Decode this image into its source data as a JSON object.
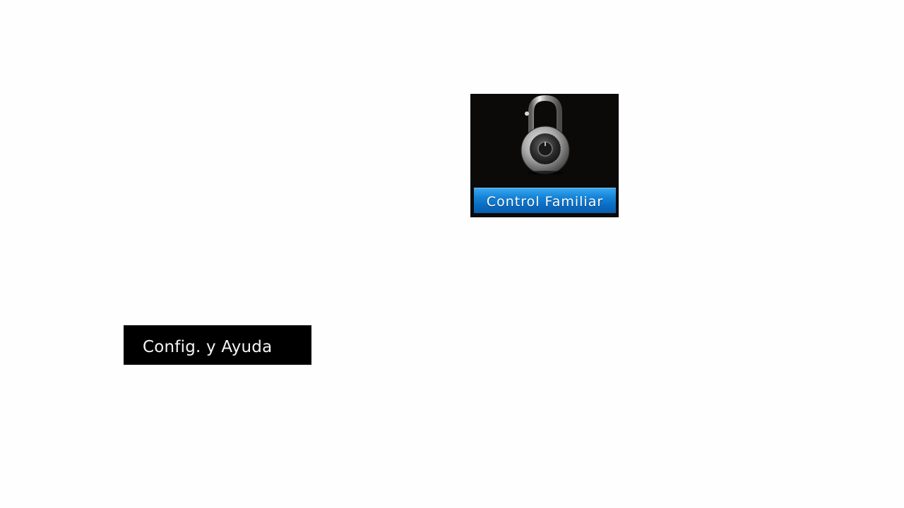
{
  "menu": {
    "config_label": "Config. y Ayuda"
  },
  "tile": {
    "caption": "Control Familiar",
    "icon": "padlock-icon",
    "caption_color": "#0a6bc2"
  },
  "colors": {
    "background": "#ffffff",
    "label_bg": "#000000",
    "tile_bg": "#0b0a09"
  }
}
